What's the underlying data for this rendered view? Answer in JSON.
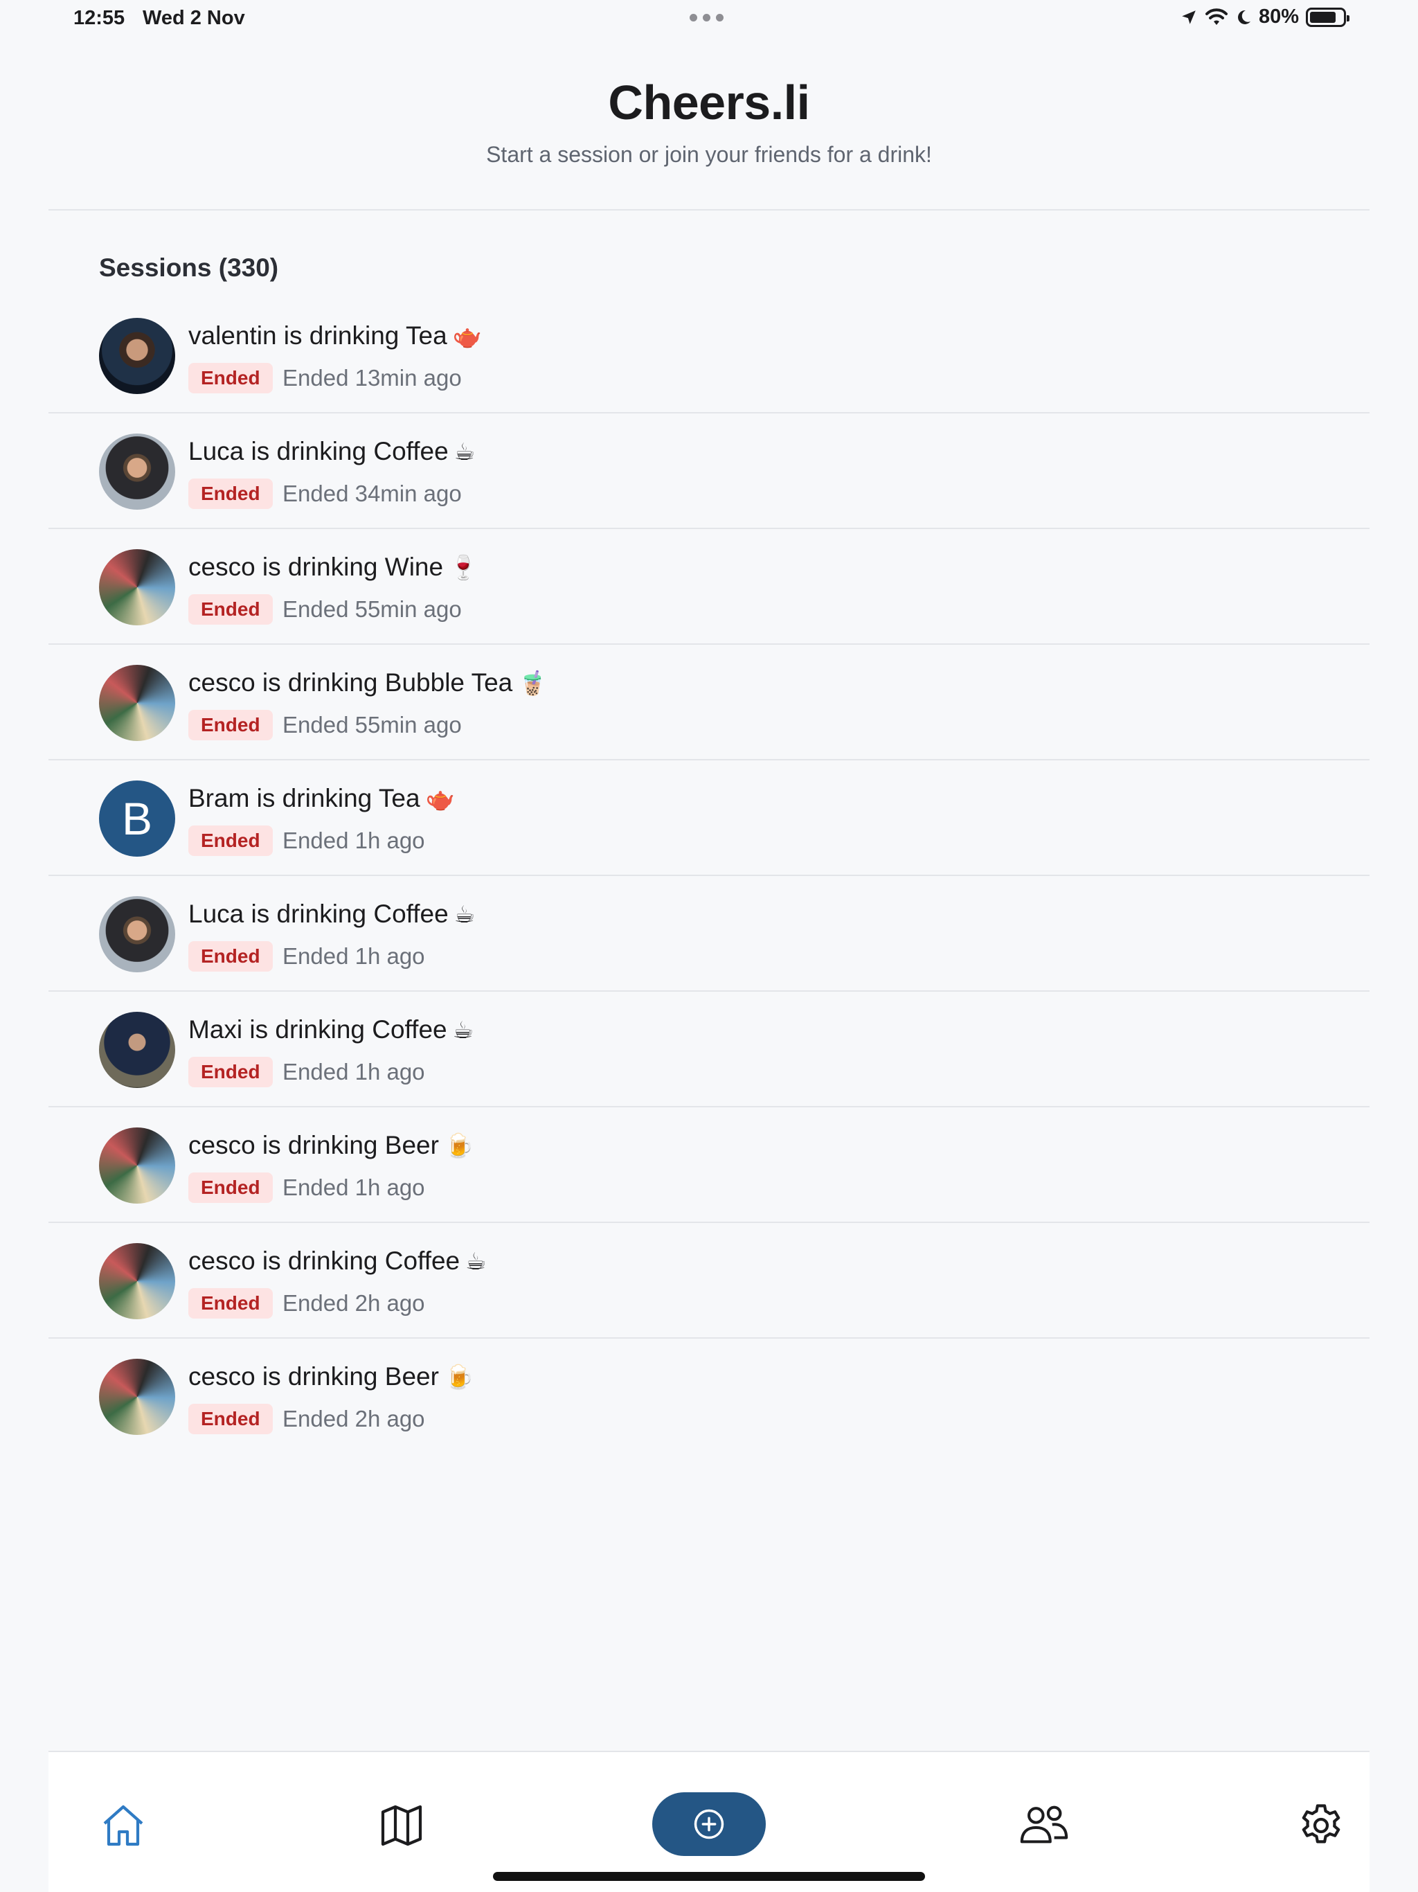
{
  "status_bar": {
    "time": "12:55",
    "date": "Wed 2 Nov",
    "battery": "80%",
    "battery_level": 0.8
  },
  "header": {
    "title": "Cheers.li",
    "subtitle": "Start a session or join your friends for a drink!"
  },
  "sessions": {
    "heading": "Sessions (330)",
    "items": [
      {
        "title": "valentin is drinking Tea",
        "emoji": "🫖",
        "status": "Ended",
        "time": "Ended 13min ago",
        "avatar": "photo-valentin"
      },
      {
        "title": "Luca is drinking Coffee",
        "emoji": "☕",
        "status": "Ended",
        "time": "Ended 34min ago",
        "avatar": "photo-luca"
      },
      {
        "title": "cesco is drinking Wine",
        "emoji": "🍷",
        "status": "Ended",
        "time": "Ended 55min ago",
        "avatar": "photo-cesco"
      },
      {
        "title": "cesco is drinking Bubble Tea",
        "emoji": "🧋",
        "status": "Ended",
        "time": "Ended 55min ago",
        "avatar": "photo-cesco"
      },
      {
        "title": "Bram is drinking Tea",
        "emoji": "🫖",
        "status": "Ended",
        "time": "Ended 1h ago",
        "avatar": "letter",
        "avatar_letter": "B"
      },
      {
        "title": "Luca is drinking Coffee",
        "emoji": "☕",
        "status": "Ended",
        "time": "Ended 1h ago",
        "avatar": "photo-luca"
      },
      {
        "title": "Maxi is drinking Coffee",
        "emoji": "☕",
        "status": "Ended",
        "time": "Ended 1h ago",
        "avatar": "photo-maxi"
      },
      {
        "title": "cesco is drinking Beer",
        "emoji": "🍺",
        "status": "Ended",
        "time": "Ended 1h ago",
        "avatar": "photo-cesco"
      },
      {
        "title": "cesco is drinking Coffee",
        "emoji": "☕",
        "status": "Ended",
        "time": "Ended 2h ago",
        "avatar": "photo-cesco"
      },
      {
        "title": "cesco is drinking Beer",
        "emoji": "🍺",
        "status": "Ended",
        "time": "Ended 2h ago",
        "avatar": "photo-cesco"
      }
    ]
  },
  "tab_bar": {
    "tabs": [
      {
        "name": "home",
        "icon": "home-icon",
        "active": true
      },
      {
        "name": "map",
        "icon": "map-icon",
        "active": false
      },
      {
        "name": "new-session",
        "icon": "plus-circle-icon",
        "active": false
      },
      {
        "name": "friends",
        "icon": "users-icon",
        "active": false
      },
      {
        "name": "settings",
        "icon": "gear-icon",
        "active": false
      }
    ]
  },
  "colors": {
    "background": "#f7f8fa",
    "accent": "#245685",
    "active_tab": "#2f7bc4",
    "badge_bg": "#fde3e3",
    "badge_text": "#b42323"
  }
}
